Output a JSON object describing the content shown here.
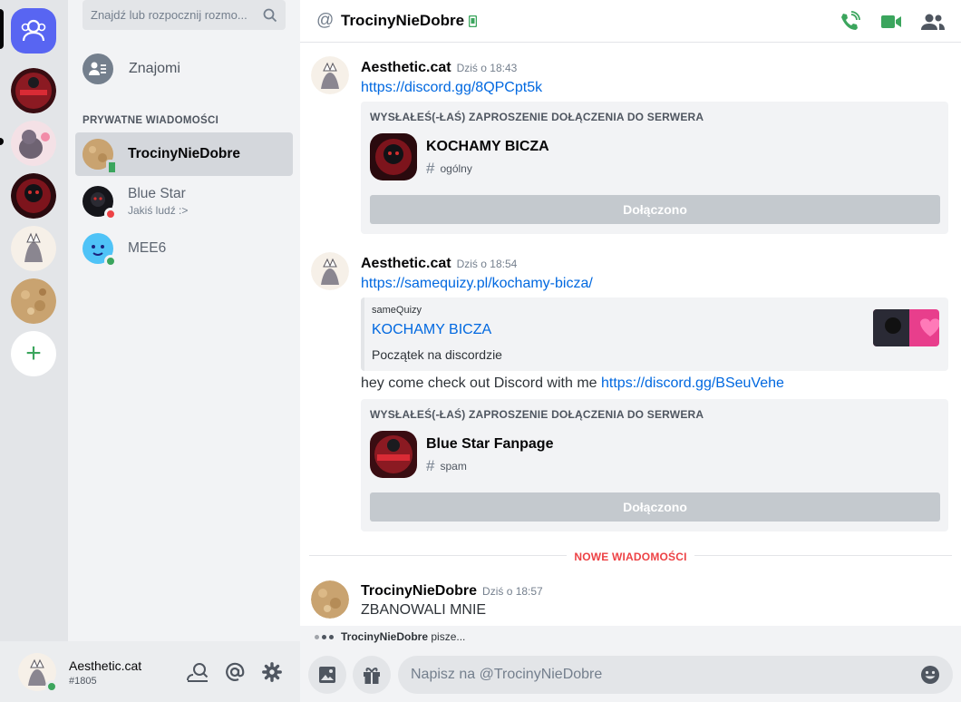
{
  "sidebar": {
    "search_placeholder": "Znajdź lub rozpocznij rozmo...",
    "friends_label": "Znajomi",
    "section_title": "PRYWATNE WIADOMOŚCI",
    "dms": [
      {
        "name": "TrocinyNieDobre",
        "status": "mobile"
      },
      {
        "name": "Blue Star",
        "subtitle": "Jakiś ludź :>",
        "status": "dnd"
      },
      {
        "name": "MEE6",
        "status": "online"
      }
    ]
  },
  "user_panel": {
    "name": "Aesthetic.cat",
    "tag": "#1805"
  },
  "header": {
    "title": "TrocinyNieDobre"
  },
  "messages": [
    {
      "author": "Aesthetic.cat",
      "time": "Dziś o 18:43",
      "link": "https://discord.gg/8QPCpt5k",
      "invite": {
        "heading": "WYSŁAŁEŚ(-ŁAŚ) ZAPROSZENIE DOŁĄCZENIA DO SERWERA",
        "server": "KOCHAMY BICZA",
        "channel": "ogólny",
        "button": "Dołączono"
      }
    },
    {
      "author": "Aesthetic.cat",
      "time": "Dziś o 18:54",
      "link": "https://samequizy.pl/kochamy-bicza/",
      "embed": {
        "provider": "sameQuizy",
        "title": "KOCHAMY BICZA",
        "description": "Początek na discordzie"
      },
      "text": "hey come check out Discord with me",
      "text_link": "https://discord.gg/BSeuVehe",
      "invite": {
        "heading": "WYSŁAŁEŚ(-ŁAŚ) ZAPROSZENIE DOŁĄCZENIA DO SERWERA",
        "server": "Blue Star Fanpage",
        "channel": "spam",
        "button": "Dołączono"
      }
    },
    {
      "author": "TrocinyNieDobre",
      "time": "Dziś o 18:57",
      "text": "ZBANOWALI MNIE"
    }
  ],
  "new_messages_label": "NOWE WIADOMOŚCI",
  "typing": {
    "user": "TrocinyNieDobre",
    "suffix": "pisze..."
  },
  "composer": {
    "placeholder": "Napisz na @TrocinyNieDobre"
  },
  "colors": {
    "accent": "#5865f2",
    "online": "#3ba55d",
    "dnd": "#ed4245",
    "link": "#0068e0",
    "new_messages": "#ed4245"
  }
}
